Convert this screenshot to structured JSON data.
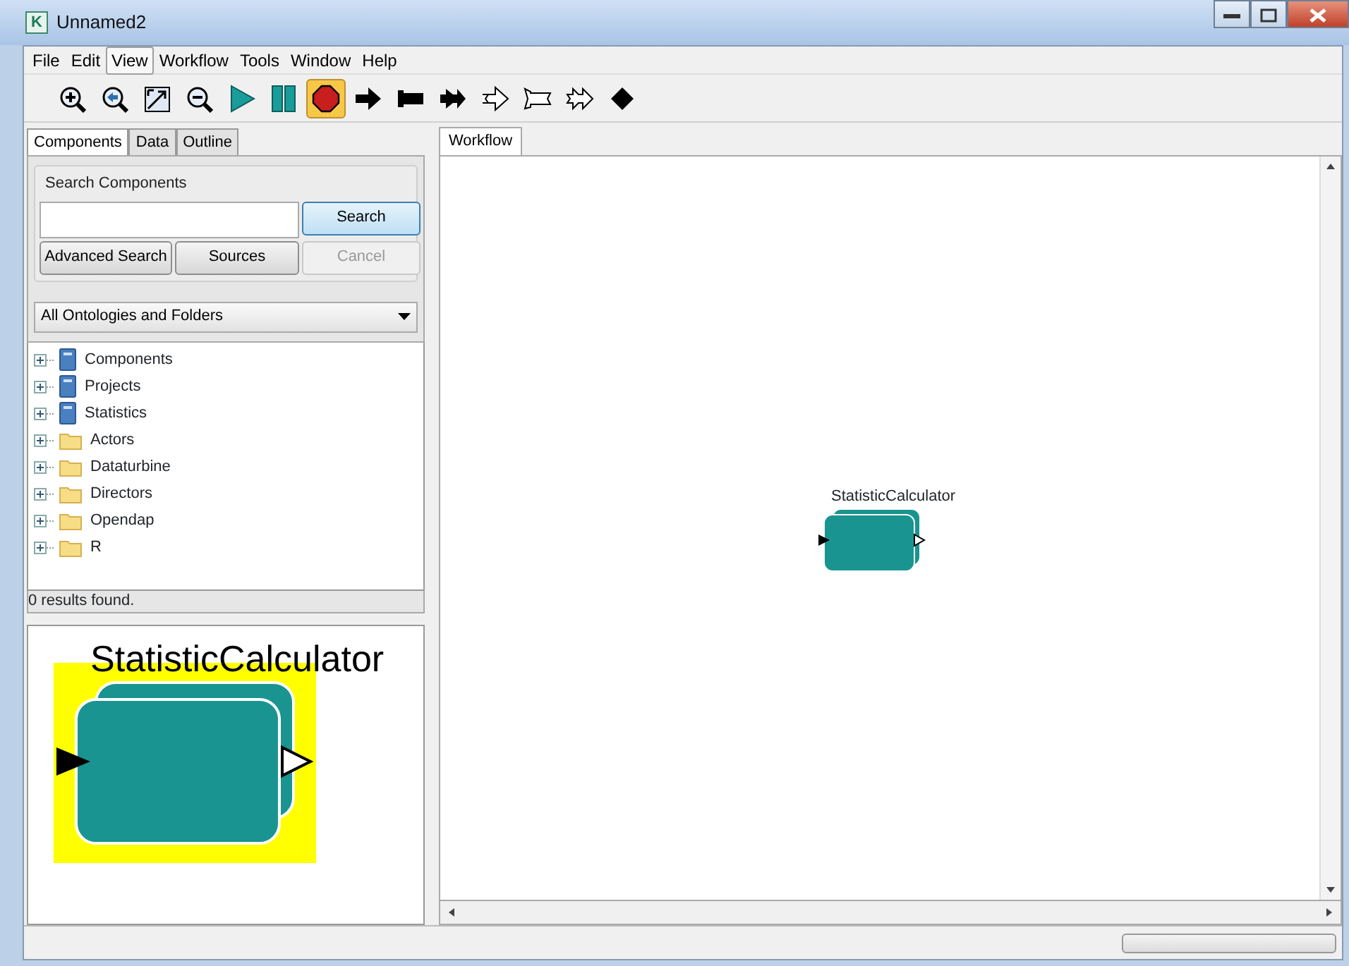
{
  "window": {
    "title": "Unnamed2",
    "app_letter": "K"
  },
  "menu": [
    {
      "label": "File",
      "selected": false
    },
    {
      "label": "Edit",
      "selected": false
    },
    {
      "label": "View",
      "selected": true
    },
    {
      "label": "Workflow",
      "selected": false
    },
    {
      "label": "Tools",
      "selected": false
    },
    {
      "label": "Window",
      "selected": false
    },
    {
      "label": "Help",
      "selected": false
    }
  ],
  "toolbar": [
    {
      "kind": "zoom-in",
      "selected": false
    },
    {
      "kind": "zoom-reset",
      "selected": false
    },
    {
      "kind": "zoom-fit",
      "selected": false
    },
    {
      "kind": "zoom-out",
      "selected": false
    },
    {
      "kind": "run",
      "selected": false
    },
    {
      "kind": "pause",
      "selected": false
    },
    {
      "kind": "stop",
      "selected": true
    },
    {
      "kind": "arrow",
      "selected": false
    },
    {
      "kind": "flag",
      "selected": false
    },
    {
      "kind": "double",
      "selected": false
    },
    {
      "kind": "outline-arrow",
      "selected": false
    },
    {
      "kind": "outline-flag",
      "selected": false
    },
    {
      "kind": "outline-double",
      "selected": false
    },
    {
      "kind": "diamond",
      "selected": false
    }
  ],
  "left_tabs": [
    {
      "label": "Components",
      "selected": true
    },
    {
      "label": "Data",
      "selected": false
    },
    {
      "label": "Outline",
      "selected": false
    }
  ],
  "search": {
    "title": "Search Components",
    "buttons": [
      {
        "label": "Search",
        "default": true,
        "disabled": false
      },
      {
        "label": "Advanced Search",
        "default": false,
        "disabled": false
      },
      {
        "label": "Sources",
        "default": false,
        "disabled": false
      },
      {
        "label": "Cancel",
        "default": false,
        "disabled": true
      }
    ]
  },
  "scope_dropdown": {
    "value": "All Ontologies and Folders"
  },
  "tree": [
    {
      "label": "Components",
      "kind": "ontology"
    },
    {
      "label": "Projects",
      "kind": "ontology"
    },
    {
      "label": "Statistics",
      "kind": "ontology"
    },
    {
      "label": "Actors",
      "kind": "folder"
    },
    {
      "label": "Dataturbine",
      "kind": "folder"
    },
    {
      "label": "Directors",
      "kind": "folder"
    },
    {
      "label": "Opendap",
      "kind": "folder"
    },
    {
      "label": "R",
      "kind": "folder"
    }
  ],
  "results": "0 results found.",
  "preview": {
    "label": "StatisticCalculator"
  },
  "workflow_tabs": [
    {
      "label": "Workflow",
      "selected": true
    }
  ],
  "canvas_actor": {
    "label": "StatisticCalculator"
  },
  "status_bar": {
    "progress": {
      "level": 0
    }
  }
}
